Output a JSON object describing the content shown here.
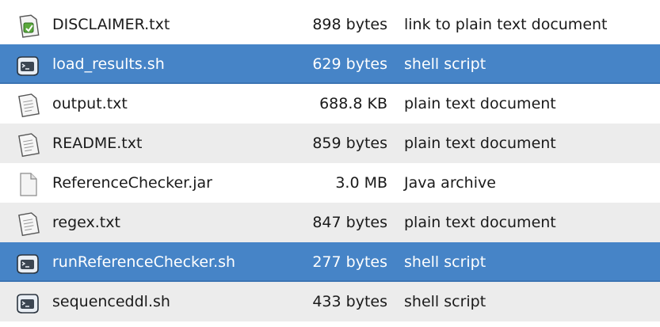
{
  "files": [
    {
      "name": "DISCLAIMER.txt",
      "size": "898 bytes",
      "type": "link to plain text document",
      "icon": "text-link-icon",
      "selected": false
    },
    {
      "name": "load_results.sh",
      "size": "629 bytes",
      "type": "shell script",
      "icon": "shell-script-icon",
      "selected": true
    },
    {
      "name": "output.txt",
      "size": "688.8 KB",
      "type": "plain text document",
      "icon": "text-document-icon",
      "selected": false
    },
    {
      "name": "README.txt",
      "size": "859 bytes",
      "type": "plain text document",
      "icon": "text-document-icon",
      "selected": false
    },
    {
      "name": "ReferenceChecker.jar",
      "size": "3.0 MB",
      "type": "Java archive",
      "icon": "generic-file-icon",
      "selected": false
    },
    {
      "name": "regex.txt",
      "size": "847 bytes",
      "type": "plain text document",
      "icon": "text-document-icon",
      "selected": false
    },
    {
      "name": "runReferenceChecker.sh",
      "size": "277 bytes",
      "type": "shell script",
      "icon": "shell-script-icon",
      "selected": true
    },
    {
      "name": "sequenceddl.sh",
      "size": "433 bytes",
      "type": "shell script",
      "icon": "shell-script-icon",
      "selected": false
    }
  ],
  "colors": {
    "selection": "#4684c7",
    "row_alt": "#ececec",
    "row": "#ffffff"
  }
}
